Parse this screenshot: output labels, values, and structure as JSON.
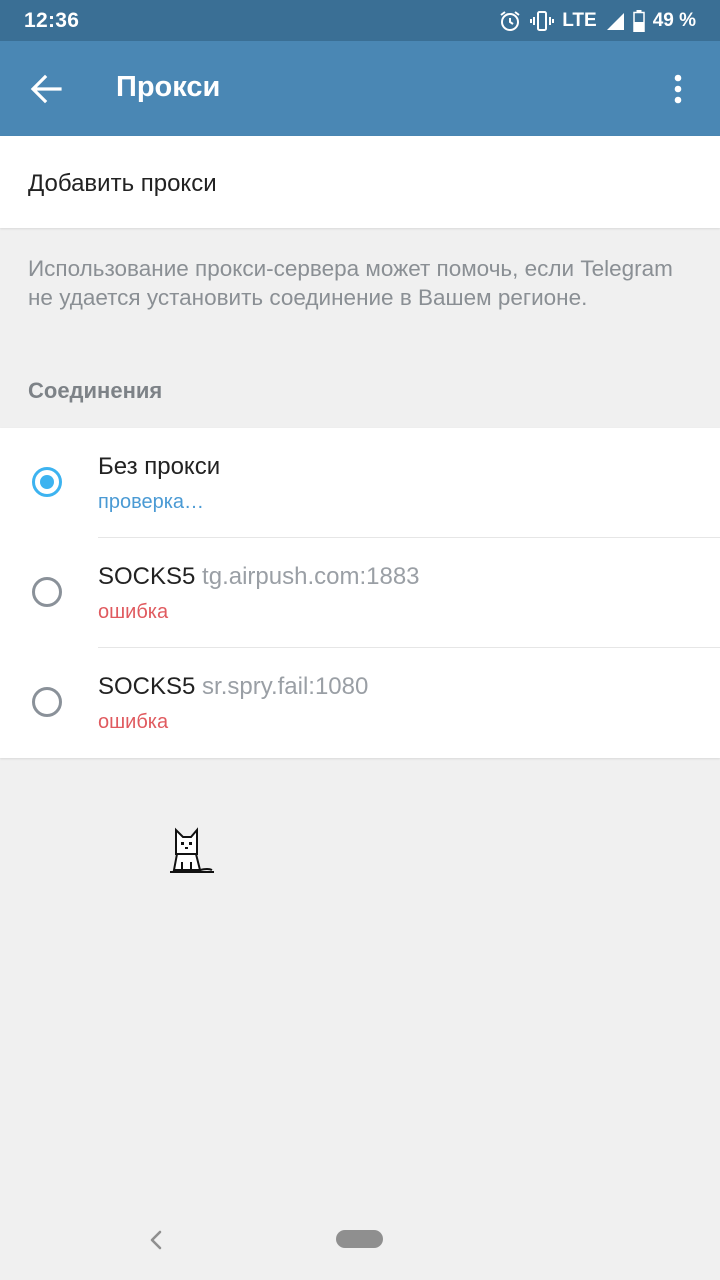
{
  "status_bar": {
    "time": "12:36",
    "network": "LTE",
    "battery": "49 %",
    "icons": [
      "alarm-icon",
      "vibrate-icon",
      "signal-icon",
      "battery-icon"
    ]
  },
  "app_bar": {
    "title": "Прокси",
    "background": "#4a87b4",
    "icons": [
      "back-arrow-icon",
      "more-vert-icon"
    ]
  },
  "add_proxy": {
    "label": "Добавить прокси"
  },
  "info_text": "Использование прокси-сервера может помочь, если Telegram не удается установить соединение в Вашем регионе.",
  "connections": {
    "header": "Соединения",
    "items": [
      {
        "title": "Без прокси",
        "address": "",
        "status": "проверка…",
        "status_kind": "checking",
        "selected": true
      },
      {
        "title": "SOCKS5",
        "address": "tg.airpush.com:1883",
        "status": "ошибка",
        "status_kind": "error",
        "selected": false
      },
      {
        "title": "SOCKS5",
        "address": "sr.spry.fail:1080",
        "status": "ошибка",
        "status_kind": "error",
        "selected": false
      }
    ]
  },
  "colors": {
    "accent": "#3db3f0",
    "error": "#e05a5f",
    "checking": "#4a9ad4"
  },
  "nav_bar": {
    "icons": [
      "nav-back-icon",
      "home-pill-icon"
    ]
  }
}
